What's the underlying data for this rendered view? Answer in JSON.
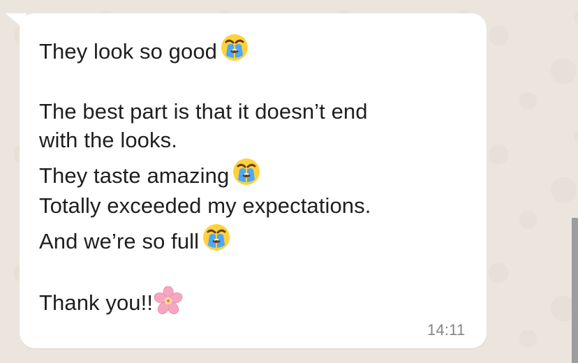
{
  "message": {
    "lines": {
      "l1": "They look so good",
      "l2": "The best part is that it doesn’t end",
      "l3": "with the looks.",
      "l4": "They taste amazing",
      "l5": "Totally exceeded my expectations.",
      "l6": "And we’re so full",
      "l7": "Thank you!!"
    },
    "emojis": [
      "loudly-crying-face-icon",
      "loudly-crying-face-icon",
      "loudly-crying-face-icon",
      "cherry-blossom-icon"
    ],
    "timestamp": "14:11"
  },
  "colors": {
    "wallpaper": "#ece5dd",
    "bubble": "#ffffff",
    "text": "#1f1f1f",
    "timestamp": "#858585",
    "scrollbar": "#9d9d9d"
  }
}
